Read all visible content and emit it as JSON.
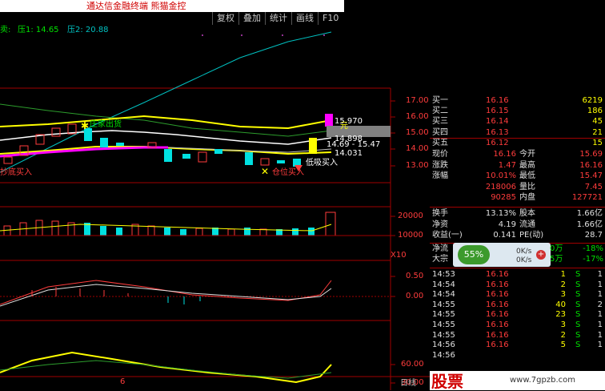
{
  "title": "通达信金融终端 熊猫金控",
  "toolbar": [
    "复权",
    "叠加",
    "统计",
    "画线",
    "F10"
  ],
  "indicator_line": {
    "prefix": "卖:",
    "ya1": "压1: 14.65",
    "ya2": "压2: 20.88"
  },
  "price_axis": [
    "17.00",
    "16.00",
    "15.00",
    "14.00",
    "13.00"
  ],
  "annotations": {
    "zhuangjia": "庄家出货",
    "hi": "15.970",
    "yuan": "元",
    "mid": "14.898",
    "range": "14.69 - 15.47",
    "low": "14.031",
    "dibu": "低吸买入",
    "cangwei": "仓位买入",
    "left_buy": "抄底买入"
  },
  "volume_axis": [
    "20000",
    "10000"
  ],
  "volume_unit": "X10",
  "macd_axis": [
    "0.50",
    "0.00"
  ],
  "kdj_axis": [
    "60.00",
    "30.00"
  ],
  "bottom_tabs": [
    "日线"
  ],
  "bottom_num": "6",
  "quote": {
    "orders": [
      {
        "label": "买一",
        "price": "16.16",
        "vol": "6219"
      },
      {
        "label": "买二",
        "price": "16.15",
        "vol": "186"
      },
      {
        "label": "买三",
        "price": "16.14",
        "vol": "45"
      },
      {
        "label": "买四",
        "price": "16.13",
        "vol": "21"
      },
      {
        "label": "买五",
        "price": "16.12",
        "vol": "15"
      }
    ],
    "stats": [
      {
        "l1": "现价",
        "v1": "16.16",
        "l2": "今开",
        "v2": "15.69"
      },
      {
        "l1": "涨跌",
        "v1": "1.47",
        "l2": "最高",
        "v2": "16.16"
      },
      {
        "l1": "涨幅",
        "v1": "10.01%",
        "l2": "最低",
        "v2": "15.47"
      },
      {
        "l1": "",
        "v1": "218006",
        "l2": "量比",
        "v2": "7.45"
      },
      {
        "l1": "",
        "v1": "90285",
        "l2": "内盘",
        "v2": "127721"
      }
    ],
    "stats2": [
      {
        "l1": "换手",
        "v1": "13.13%",
        "l2": "股本",
        "v2": "1.66亿"
      },
      {
        "l1": "净资",
        "v1": "4.19",
        "l2": "流通",
        "v2": "1.66亿"
      },
      {
        "l1": "收益(一)",
        "v1": "0.141",
        "l2": "PE(动)",
        "v2": "28.7"
      }
    ],
    "flow": [
      {
        "l": "净流",
        "v": "0万",
        "p": "-18%"
      },
      {
        "l": "大宗",
        "v": "5万",
        "p": "-17%"
      }
    ],
    "speed": {
      "pct": "55%",
      "up": "0K/s",
      "down": "0K/s"
    },
    "ticks": [
      {
        "t": "14:53",
        "p": "16.16",
        "v": "1",
        "s": "S",
        "n": "1"
      },
      {
        "t": "14:54",
        "p": "16.16",
        "v": "2",
        "s": "S",
        "n": "1"
      },
      {
        "t": "14:54",
        "p": "16.16",
        "v": "3",
        "s": "S",
        "n": "1"
      },
      {
        "t": "14:55",
        "p": "16.16",
        "v": "40",
        "s": "S",
        "n": "2"
      },
      {
        "t": "14:55",
        "p": "16.16",
        "v": "23",
        "s": "S",
        "n": "1"
      },
      {
        "t": "14:55",
        "p": "16.16",
        "v": "3",
        "s": "S",
        "n": "1"
      },
      {
        "t": "14:55",
        "p": "16.16",
        "v": "2",
        "s": "S",
        "n": "1"
      },
      {
        "t": "14:56",
        "p": "16.16",
        "v": "5",
        "s": "S",
        "n": "1"
      },
      {
        "t": "14:56",
        "p": "",
        "v": "",
        "s": "",
        "n": ""
      }
    ]
  },
  "watermark": {
    "cn": "股票",
    "url": "www.7gpzb.com"
  },
  "colors": {
    "red": "#ff3c3c",
    "yellow": "#ffff00",
    "green": "#00e000",
    "cyan": "#00ffff",
    "magenta": "#ff00ff"
  }
}
